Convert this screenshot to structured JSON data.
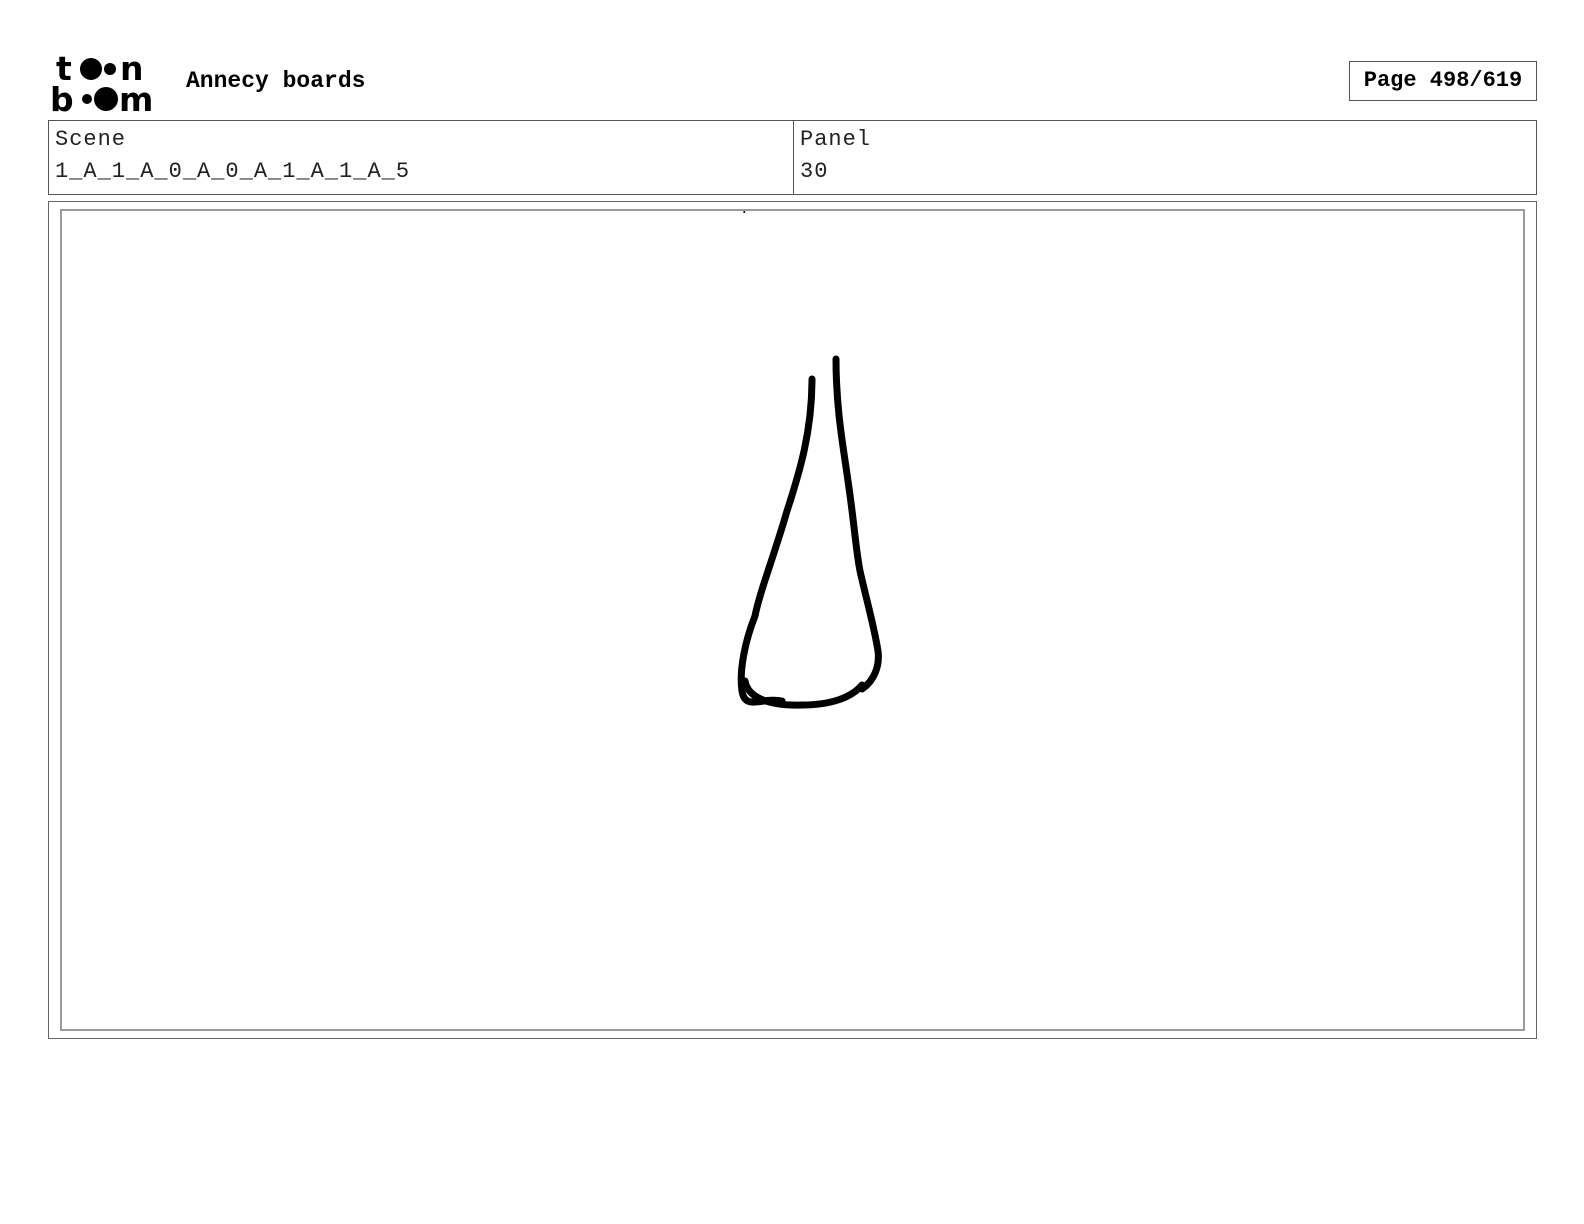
{
  "header": {
    "logo_text": [
      "to",
      "n",
      "b",
      "m"
    ],
    "project_title": "Annecy boards",
    "page_label": "Page 498/619"
  },
  "info": {
    "scene_label": "Scene",
    "scene_value": "1_A_1_A_0_A_0_A_1_A_1_A_5",
    "panel_label": "Panel",
    "panel_value": "30"
  },
  "panel_image": {
    "subject": "teardrop-sketch",
    "stroke_color": "#000000"
  }
}
